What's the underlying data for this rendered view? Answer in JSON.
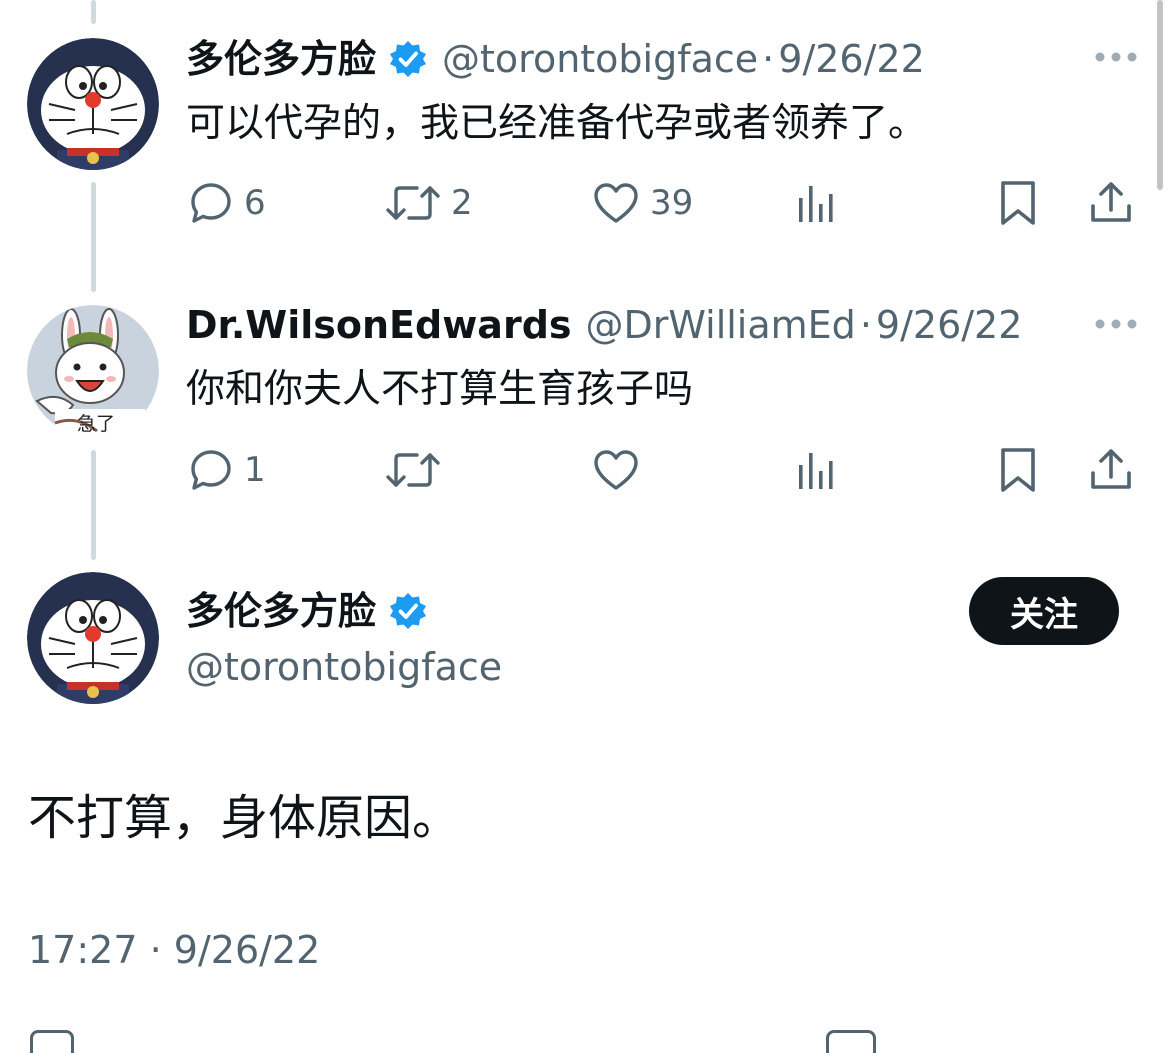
{
  "tweets": [
    {
      "display_name": "多伦多方脸",
      "handle": "@torontobigface",
      "separator": "·",
      "date": "9/26/22",
      "text": "可以代孕的，我已经准备代孕或者领养了。",
      "avatar_icon": "doraemon-avatar-icon",
      "verified": true,
      "actions": {
        "reply_count": "6",
        "retweet_count": "2",
        "like_count": "39"
      }
    },
    {
      "display_name": "Dr.WilsonEdwards",
      "handle": "@DrWilliamEd",
      "separator": "·",
      "date": "9/26/22",
      "text": "你和你夫人不打算生育孩子吗",
      "avatar_icon": "rabbit-avatar-icon",
      "avatar_caption": "急了",
      "verified": false,
      "actions": {
        "reply_count": "1"
      }
    }
  ],
  "main_tweet": {
    "display_name": "多伦多方脸",
    "handle": "@torontobigface",
    "follow_label": "关注",
    "text": "不打算，身体原因。",
    "time": "17:27",
    "separator": "·",
    "date": "9/26/22",
    "verified": true
  },
  "colors": {
    "verified_blue": "#1d9bf0",
    "secondary_text": "#536471",
    "primary_text": "#0f1419",
    "thread_line": "#cfd9de"
  }
}
